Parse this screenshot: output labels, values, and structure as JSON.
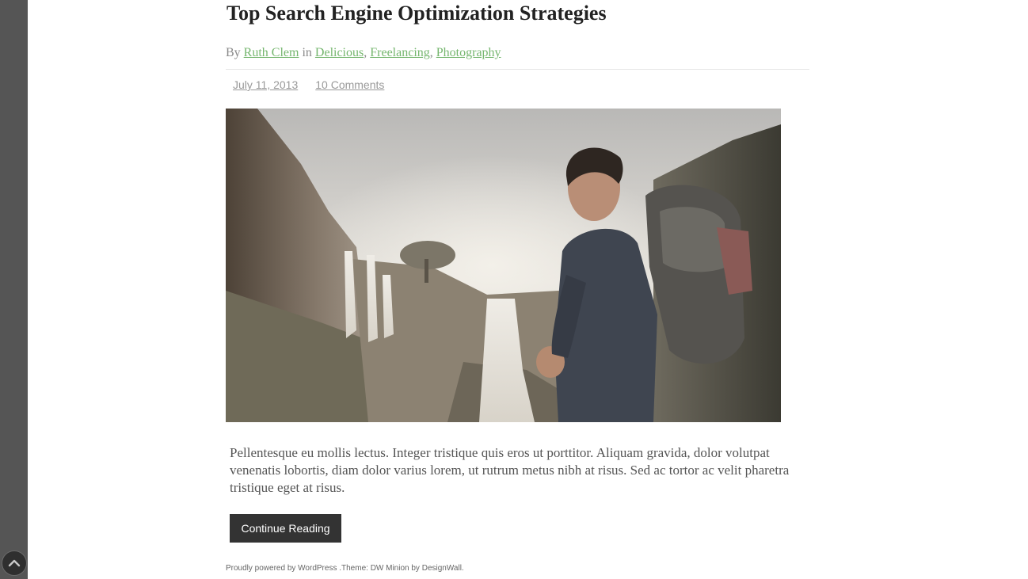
{
  "post": {
    "title": "Top Search Engine Optimization Strategies",
    "by_prefix": "By",
    "author": "Ruth Clem",
    "in_word": "in",
    "categories": [
      "Delicious",
      "Freelancing",
      "Photography"
    ],
    "date": "July 11, 2013",
    "comments": "10 Comments",
    "excerpt": "Pellentesque eu mollis lectus. Integer tristique quis eros ut porttitor. Aliquam gravida, dolor volutpat venenatis lobortis, diam dolor varius lorem, ut rutrum metus nibh at risus. Sed ac tortor ac velit pharetra tristique eget at risus.",
    "continue_label": "Continue Reading"
  },
  "footer": {
    "text_1": "Proudly powered by ",
    "wordpress": "WordPress",
    "text_2": " .Theme: DW Minion by ",
    "designwall": "DesignWall",
    "text_3": "."
  },
  "colors": {
    "link_green": "#75b66e",
    "sidebar": "#555555",
    "button": "#333333"
  },
  "icons": {
    "back_to_top": "chevron-up-icon"
  }
}
